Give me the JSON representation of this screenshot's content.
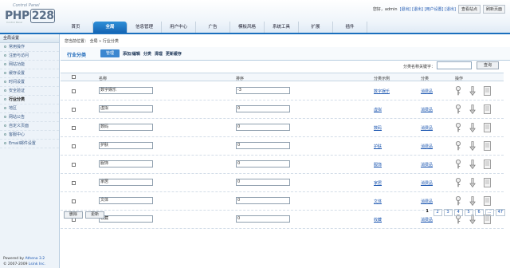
{
  "logo": {
    "top": "Control Panel",
    "main": "PHP",
    "num": "228",
    "sub": "Control Panel"
  },
  "userbar": {
    "greeting": "您好，admin",
    "links": "[退出] [退出] [用户设置] [退出]",
    "home_btn": "查看站点",
    "refresh_btn": "刷新页面"
  },
  "nav": [
    "首页",
    "全局",
    "信息管理",
    "用户中心",
    "广告",
    "模板风格",
    "系统工具",
    "扩展",
    "插件"
  ],
  "sidebar": {
    "head": "全局设置",
    "items": [
      "常用操作",
      "注册与访问",
      "网站功能",
      "缓存设置",
      "时间设置",
      "安全验证",
      "行业分类",
      "地区",
      "网站公告",
      "自定义页面",
      "客服中心",
      "Email邮件设置"
    ],
    "footer_powered": "Powered by",
    "footer_product": "Athena 3.2",
    "footer_copy": "© 2007-2009",
    "footer_company": "Lsink Inc."
  },
  "crumb": "您当前位置： 全局 » 行业分类",
  "section_title": "行业分类",
  "tabs": {
    "manage": "管理",
    "links": [
      "添加/编辑",
      "分类",
      "清理",
      "更新缓存"
    ]
  },
  "search": {
    "label": "分类名称关键字：",
    "value": "",
    "button": "查询"
  },
  "table": {
    "headers": {
      "name": "名称",
      "sort": "排序",
      "example": "分类示例",
      "cls": "分类",
      "ops": "操作"
    },
    "rows": [
      {
        "name": "数字娱乐",
        "sort": "-3",
        "example": "数字娱乐",
        "cls": "消费品"
      },
      {
        "name": "虚拟",
        "sort": "0",
        "example": "虚拟",
        "cls": "消费品"
      },
      {
        "name": "数码",
        "sort": "0",
        "example": "数码",
        "cls": "消费品"
      },
      {
        "name": "护肤",
        "sort": "0",
        "example": "护肤",
        "cls": "消费品"
      },
      {
        "name": "服饰",
        "sort": "0",
        "example": "服饰",
        "cls": "消费品"
      },
      {
        "name": "家居",
        "sort": "0",
        "example": "家居",
        "cls": "消费品"
      },
      {
        "name": "文体",
        "sort": "0",
        "example": "文体",
        "cls": "消费品"
      },
      {
        "name": "收藏",
        "sort": "0",
        "example": "收藏",
        "cls": "消费品"
      }
    ]
  },
  "actions": {
    "delete": "删除",
    "update": "更新"
  },
  "pager": [
    "1",
    "2",
    "3",
    "4",
    "5",
    "6",
    "...",
    "47"
  ]
}
